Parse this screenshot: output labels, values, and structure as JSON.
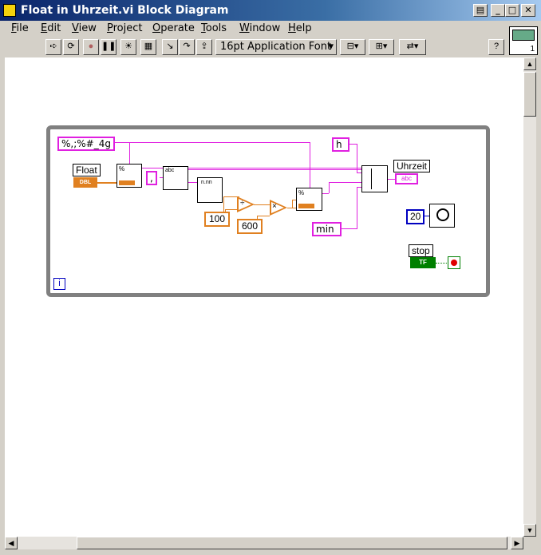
{
  "window": {
    "title": "Float in Uhrzeit.vi Block Diagram"
  },
  "menu": [
    "File",
    "Edit",
    "View",
    "Project",
    "Operate",
    "Tools",
    "Window",
    "Help"
  ],
  "menu_underline": [
    "F",
    "E",
    "V",
    "P",
    "O",
    "T",
    "W",
    "H"
  ],
  "toolbar": {
    "font_select": "16pt Application Font"
  },
  "vi_icon_label": "1",
  "diagram": {
    "format_string": "%,;%#_4g",
    "float_label": "Float",
    "float_type": "DBL",
    "comma_const": ",",
    "h_const": "h",
    "min_const": "min",
    "const_100": "100",
    "const_600": "600",
    "const_20": "20",
    "uhrzeit_label": "Uhrzeit",
    "uhrzeit_type": "abc",
    "stop_label": "stop",
    "stop_type": "TF",
    "loop_index": "i"
  },
  "colors": {
    "string_wire": "#e020e0",
    "numeric_wire": "#e08020",
    "int_wire": "#0000c0",
    "bool_wire": "#008000"
  }
}
